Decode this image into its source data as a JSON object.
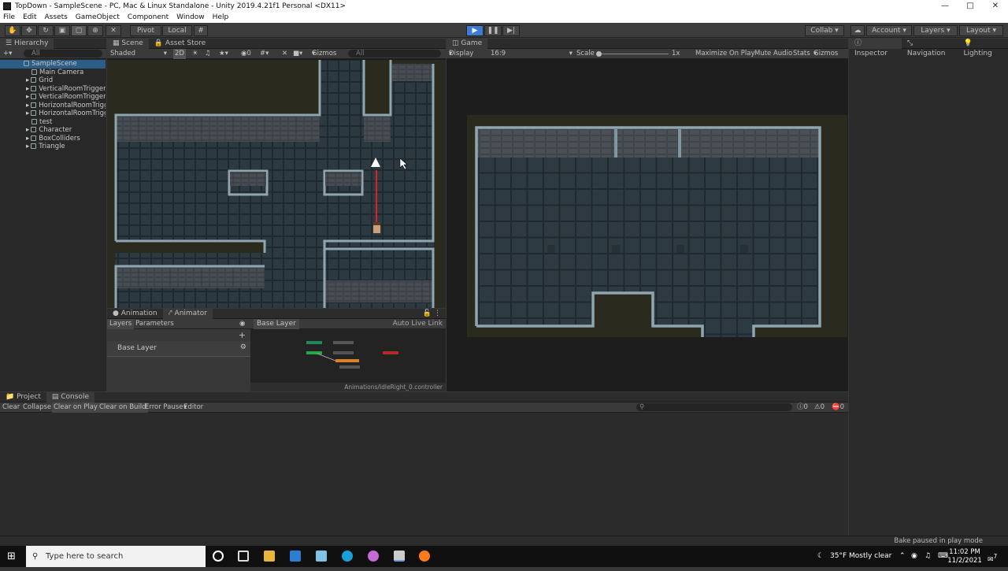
{
  "window": {
    "title": "TopDown - SampleScene - PC, Mac & Linux Standalone - Unity 2019.4.21f1 Personal <DX11>"
  },
  "menu": [
    "File",
    "Edit",
    "Assets",
    "GameObject",
    "Component",
    "Window",
    "Help"
  ],
  "toolbar": {
    "pivot": "Pivot",
    "local": "Local",
    "collab": "Collab",
    "account": "Account",
    "layers": "Layers",
    "layout": "Layout"
  },
  "hierarchy": {
    "tab": "Hierarchy",
    "search": "All",
    "scene": "SampleScene",
    "items": [
      "Main Camera",
      "Grid",
      "VerticalRoomTrigger",
      "VerticalRoomTrigger (",
      "HorizontalRoomTrigg",
      "HorizontalRoomTrigg",
      "test",
      "Character",
      "BoxColliders",
      "Triangle"
    ]
  },
  "scene": {
    "tab": "Scene",
    "asset_store": "Asset Store",
    "shaded": "Shaded",
    "mode2d": "2D",
    "gizmos": "Gizmos",
    "search": "All"
  },
  "game": {
    "tab": "Game",
    "display": "Display 1",
    "aspect": "16:9",
    "scale_label": "Scale",
    "scale_value": "1x",
    "maximize": "Maximize On Play",
    "mute": "Mute Audio",
    "stats": "Stats",
    "gizmos": "Gizmos"
  },
  "inspector": {
    "inspector": "Inspector",
    "navigation": "Navigation",
    "lighting": "Lighting"
  },
  "animator": {
    "animation": "Animation",
    "animator": "Animator",
    "layers": "Layers",
    "parameters": "Parameters",
    "base_layer": "Base Layer",
    "breadcrumb": "Base Layer",
    "auto_live": "Auto Live Link",
    "path": "Animations/IdleRight_0.controller"
  },
  "console": {
    "project": "Project",
    "console": "Console",
    "clear": "Clear",
    "collapse": "Collapse",
    "clear_on_play": "Clear on Play",
    "clear_on_build": "Clear on Build",
    "error_pause": "Error Pause",
    "editor": "Editor",
    "count_info": "0",
    "count_warn": "0",
    "count_err": "0",
    "status": "Bake paused in play mode"
  },
  "taskbar": {
    "search": "Type here to search",
    "weather": "35°F  Mostly clear",
    "time": "11:02 PM",
    "date": "11/2/2021",
    "notif": "7"
  },
  "colors": {
    "accent": "#3d7bd4",
    "panel": "#282828",
    "tile": "#2f3b43",
    "wall": "#5e6f78",
    "play": "#2b6cc4"
  }
}
